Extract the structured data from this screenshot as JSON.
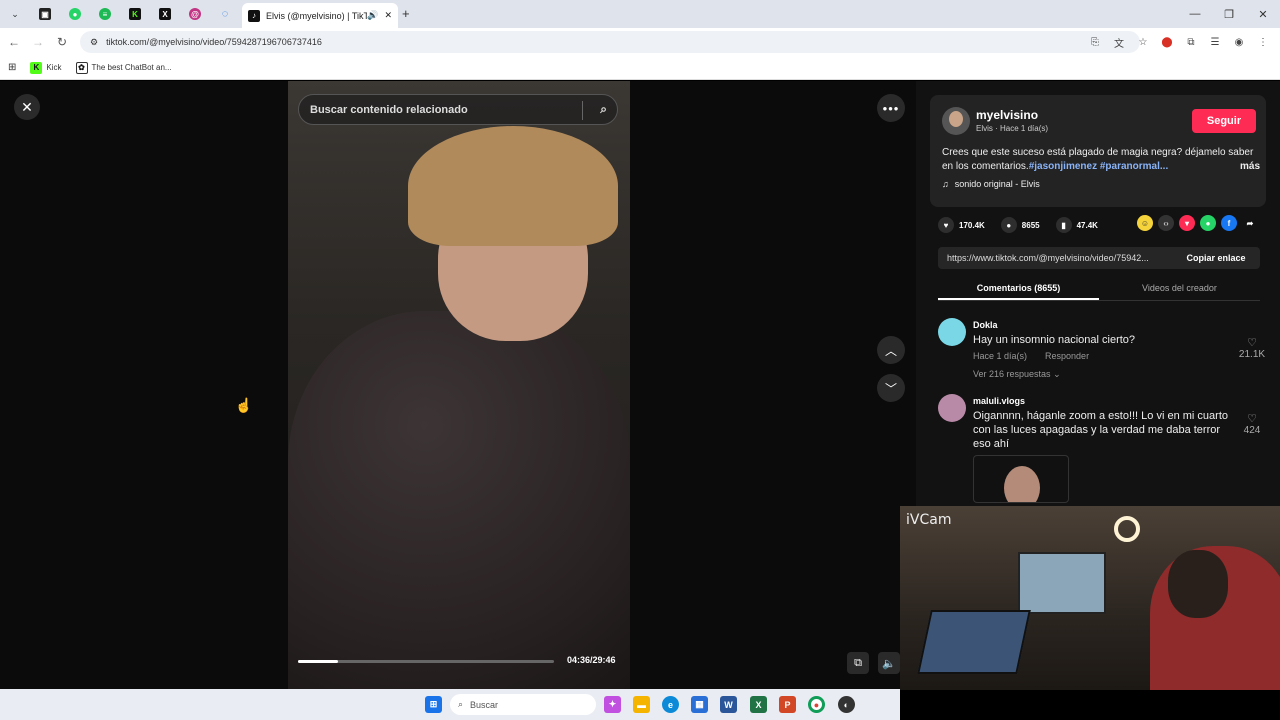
{
  "browser": {
    "tab_title": "Elvis (@myelvisino) | TikTok",
    "url": "tiktok.com/@myelvisino/video/7594287196706737416",
    "bookmarks": [
      {
        "label": "Kick"
      },
      {
        "label": "The best ChatBot an..."
      }
    ]
  },
  "viewer": {
    "search_placeholder": "Buscar contenido relacionado",
    "time": "04:36/29:46",
    "progress_fraction": 0.155
  },
  "post": {
    "username": "myelvisino",
    "subline": "Elvis · Hace 1 día(s)",
    "follow_label": "Seguir",
    "description": "Crees que este suceso está plagado de magia negra? déjamelo saber en los comentarios.",
    "tags": "#jasonjimenez #paranormal...",
    "more_label": "más",
    "sound": "sonido original - Elvis",
    "likes": "170.4K",
    "comments_count": "8655",
    "saves": "47.4K",
    "share_link": "https://www.tiktok.com/@myelvisino/video/75942...",
    "copy_label": "Copiar enlace",
    "tab_comments": "Comentarios (8655)",
    "tab_creator": "Videos del creador"
  },
  "comments": [
    {
      "user": "Dokla",
      "text": "Hay un insomnio nacional cierto?",
      "time": "Hace 1 día(s)",
      "reply_label": "Responder",
      "replies": "Ver 216 respuestas",
      "likes": "21.1K"
    },
    {
      "user": "maluli.vlogs",
      "text": "Oigannnn, háganle zoom a esto!!! Lo vi en mi cuarto con las luces apagadas y la verdad me daba terror eso ahí",
      "likes": "424"
    }
  ],
  "webcam": {
    "label": "iVCam"
  },
  "taskbar": {
    "search_placeholder": "Buscar"
  },
  "colors": {
    "accent": "#fe2c55",
    "tag": "#8ab4f8"
  }
}
